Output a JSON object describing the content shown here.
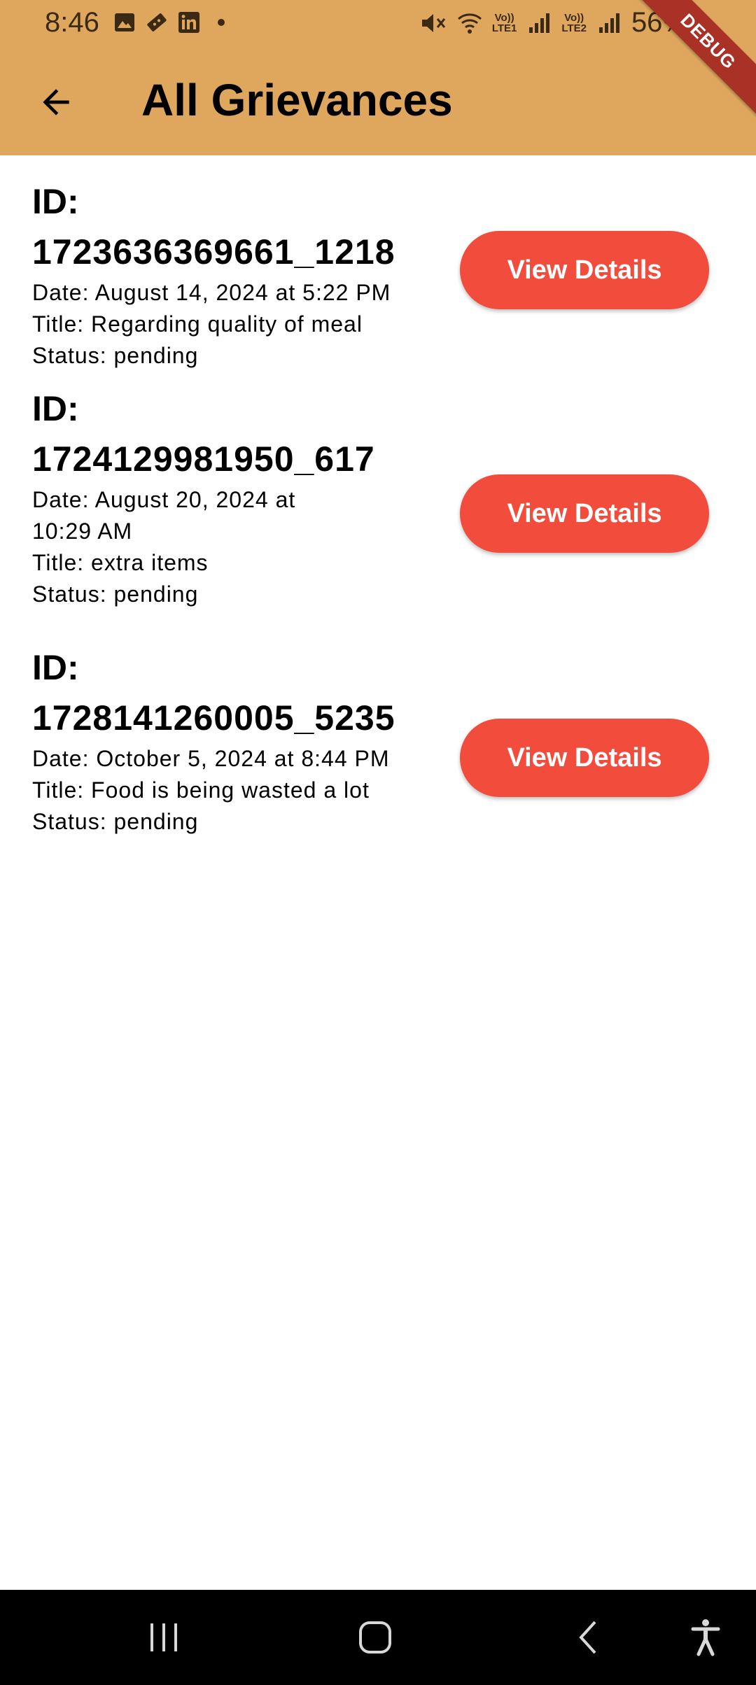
{
  "status_bar": {
    "time": "8:46",
    "battery_text": "56%",
    "sim1_label_top": "Vo))",
    "sim1_label_bottom": "LTE1",
    "sim2_label_top": "Vo))",
    "sim2_label_bottom": "LTE2"
  },
  "debug_banner": "DEBUG",
  "app_bar": {
    "title": "All Grievances",
    "background_color": "#DFA75E"
  },
  "grievances": [
    {
      "id_label": "ID:",
      "id": "1723636369661_1218",
      "date": "Date: August 14, 2024 at 5:22 PM",
      "title": "Title: Regarding quality of meal",
      "status": "Status: pending",
      "button_label": "View Details"
    },
    {
      "id_label": "ID:",
      "id": "1724129981950_617",
      "date": "Date: August 20, 2024 at 10:29 AM",
      "title": "Title: extra items",
      "status": "Status: pending",
      "button_label": "View Details"
    },
    {
      "id_label": "ID:",
      "id": "1728141260005_5235",
      "date": "Date: October 5, 2024 at 8:44 PM",
      "title": "Title: Food is being wasted a lot",
      "status": "Status: pending",
      "button_label": "View Details"
    }
  ],
  "colors": {
    "button": "#F24C3D",
    "nav_bar": "#000000"
  },
  "icons": {
    "back": "arrow-left-icon",
    "nav_recents": "recents-icon",
    "nav_home": "home-icon",
    "nav_back": "chevron-left-icon",
    "nav_accessibility": "accessibility-icon"
  }
}
